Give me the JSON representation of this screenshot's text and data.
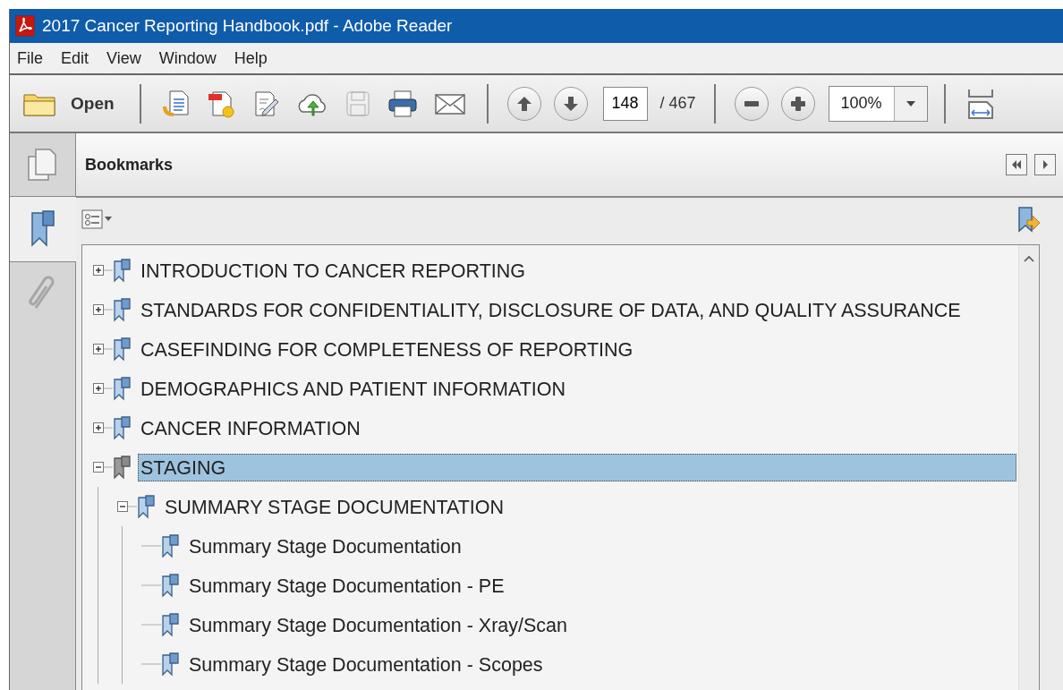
{
  "window": {
    "title": "2017 Cancer Reporting Handbook.pdf - Adobe Reader"
  },
  "menu": [
    "File",
    "Edit",
    "View",
    "Window",
    "Help"
  ],
  "toolbar": {
    "open_label": "Open",
    "save": {
      "disabled": true
    },
    "page": "148",
    "page_total": "/ 467",
    "zoom": "100%"
  },
  "side_tabs": [
    {
      "kind": "pages",
      "selected": false
    },
    {
      "kind": "bookmarks",
      "selected": true
    },
    {
      "kind": "attachments",
      "selected": false
    }
  ],
  "panel": {
    "title": "Bookmarks"
  },
  "bookmarks": [
    {
      "label": "INTRODUCTION TO CANCER REPORTING",
      "expanded": false,
      "selected": false
    },
    {
      "label": "STANDARDS FOR CONFIDENTIALITY, DISCLOSURE OF DATA, AND QUALITY ASSURANCE",
      "expanded": false,
      "selected": false
    },
    {
      "label": "CASEFINDING FOR COMPLETENESS OF REPORTING",
      "expanded": false,
      "selected": false
    },
    {
      "label": "DEMOGRAPHICS AND PATIENT INFORMATION",
      "expanded": false,
      "selected": false
    },
    {
      "label": "CANCER INFORMATION",
      "expanded": false,
      "selected": false
    },
    {
      "label": "STAGING",
      "expanded": true,
      "selected": true,
      "children": [
        {
          "label": "SUMMARY STAGE DOCUMENTATION",
          "expanded": true,
          "selected": false,
          "children": [
            {
              "label": "Summary Stage Documentation",
              "selected": false
            },
            {
              "label": "Summary Stage Documentation - PE",
              "selected": false
            },
            {
              "label": "Summary Stage Documentation - Xray/Scan",
              "selected": false
            },
            {
              "label": "Summary Stage Documentation - Scopes",
              "selected": false
            }
          ]
        }
      ]
    }
  ]
}
